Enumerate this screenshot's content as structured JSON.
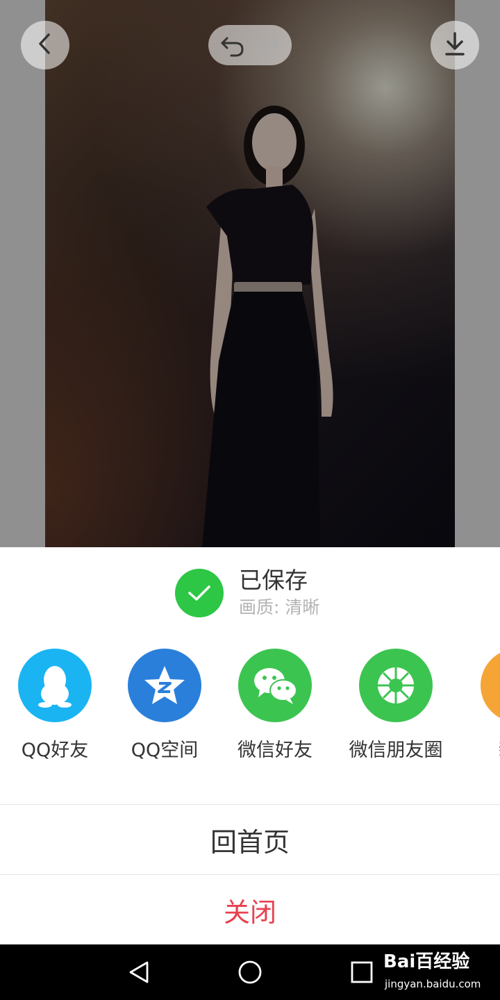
{
  "toolbar": {
    "back_icon": "chevron-left-icon",
    "undo_icon": "undo-icon",
    "redo_icon": "redo-icon",
    "download_icon": "download-icon"
  },
  "save_status": {
    "icon": "check-icon",
    "title": "已保存",
    "quality": "画质: 清晰"
  },
  "share": {
    "items": [
      {
        "label": "QQ好友",
        "icon": "qq-penguin-icon",
        "color": "#1ab4f2"
      },
      {
        "label": "QQ空间",
        "icon": "qzone-star-icon",
        "color": "#2a7fdb"
      },
      {
        "label": "微信好友",
        "icon": "wechat-icon",
        "color": "#3cc451"
      },
      {
        "label": "微信朋友圈",
        "icon": "moments-icon",
        "color": "#3cc451"
      },
      {
        "label": "新浪",
        "icon": "weibo-icon",
        "color": "#f5a536"
      }
    ]
  },
  "actions": {
    "home_label": "回首页",
    "close_label": "关闭"
  },
  "colors": {
    "close_text": "#e8414f",
    "check_green": "#2dc645"
  },
  "navbar": {
    "back_icon": "nav-back-icon",
    "home_icon": "nav-home-icon",
    "recent_icon": "nav-recent-icon"
  },
  "watermark": {
    "brand": "Bai百经验",
    "url": "jingyan.baidu.com"
  }
}
